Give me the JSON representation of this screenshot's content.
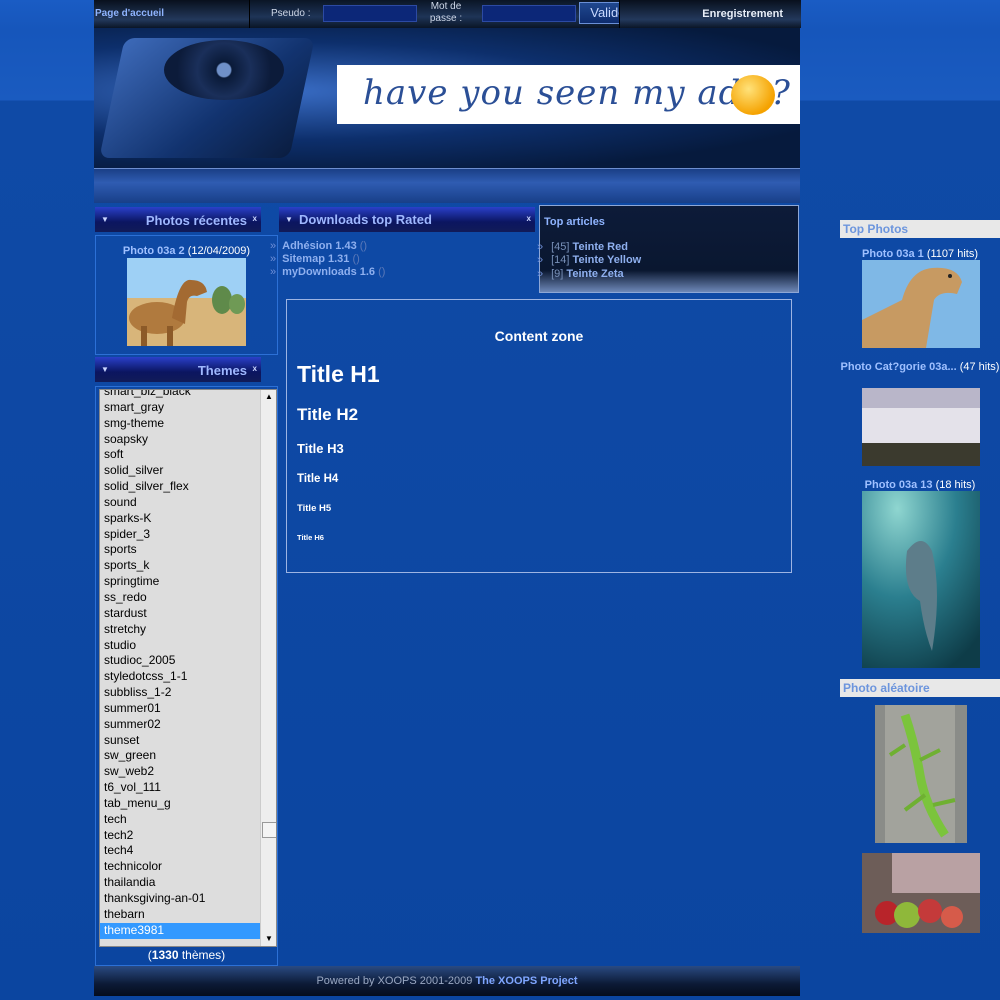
{
  "topbar": {
    "home": "Page d'accueil",
    "pseudo_label": "Pseudo :",
    "pass_label": "Mot de passe :",
    "submit": "Valider",
    "register": "Enregistrement"
  },
  "banner": {
    "ad_text": "have you seen my ads ?"
  },
  "recent_photos": {
    "title": "Photos récentes",
    "photo_link": "Photo 03a 2",
    "photo_date": "(12/04/2009)"
  },
  "themes": {
    "title": "Themes",
    "items": [
      "smart_biz_black",
      "smart_gray",
      "smg-theme",
      "soapsky",
      "soft",
      "solid_silver",
      "solid_silver_flex",
      "sound",
      "sparks-K",
      "spider_3",
      "sports",
      "sports_k",
      "springtime",
      "ss_redo",
      "stardust",
      "stretchy",
      "studio",
      "studioc_2005",
      "styledotcss_1-1",
      "subbliss_1-2",
      "summer01",
      "summer02",
      "sunset",
      "sw_green",
      "sw_web2",
      "t6_vol_111",
      "tab_menu_g",
      "tech",
      "tech2",
      "tech4",
      "technicolor",
      "thailandia",
      "thanksgiving-an-01",
      "thebarn",
      "theme3981"
    ],
    "selected": "theme3981",
    "count": "1330",
    "count_suffix": " thèmes)"
  },
  "downloads": {
    "title": "Downloads top Rated",
    "items": [
      "Adhésion 1.43",
      "Sitemap 1.31",
      "myDownloads 1.6"
    ]
  },
  "top_articles": {
    "title": "Top articles",
    "items": [
      {
        "count": "[45]",
        "label": "Teinte Red"
      },
      {
        "count": "[14]",
        "label": "Teinte Yellow"
      },
      {
        "count": "[9]",
        "label": "Teinte Zeta"
      }
    ]
  },
  "content": {
    "zone_title": "Content zone",
    "h1": "Title H1",
    "h2": "Title H2",
    "h3": "Title H3",
    "h4": "Title H4",
    "h5": "Title H5",
    "h6": "Title H6"
  },
  "footer": {
    "prefix": "Powered by XOOPS 2001-2009 ",
    "link": "The XOOPS Project"
  },
  "top_photos": {
    "title": "Top Photos",
    "items": [
      {
        "link": "Photo 03a 1",
        "hits": " (1107 hits)"
      },
      {
        "link": "Photo Cat?gorie 03a...",
        "hits": " (47 hits)"
      },
      {
        "link": "Photo 03a 13",
        "hits": " (18 hits)"
      }
    ]
  },
  "random_photo": {
    "title": "Photo aléatoire"
  },
  "colors": {
    "accent": "#8fb4ff",
    "page_bg": "#0b45a0",
    "selected": "#3399ff"
  }
}
